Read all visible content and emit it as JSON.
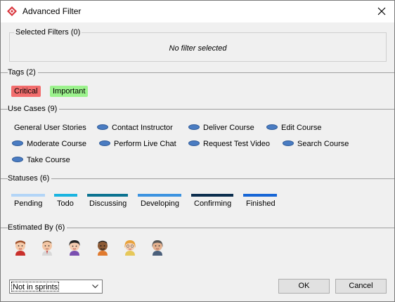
{
  "window": {
    "title": "Advanced Filter"
  },
  "selected_filters": {
    "label": "Selected Filters (0)",
    "empty_text": "No filter selected"
  },
  "tags": {
    "label": "Tags (2)",
    "items": [
      {
        "label": "Critical",
        "color": "#f26d6d"
      },
      {
        "label": "Important",
        "color": "#9cf28d"
      }
    ]
  },
  "use_cases": {
    "label": "Use Cases (9)",
    "items": [
      {
        "label": "General User Stories",
        "icon": "none"
      },
      {
        "label": "Contact Instructor",
        "icon": "use-case-icon"
      },
      {
        "label": "Deliver Course",
        "icon": "use-case-icon"
      },
      {
        "label": "Edit Course",
        "icon": "use-case-icon"
      },
      {
        "label": "Moderate Course",
        "icon": "use-case-icon"
      },
      {
        "label": "Perform Live Chat",
        "icon": "use-case-icon"
      },
      {
        "label": "Request Test Video",
        "icon": "use-case-icon"
      },
      {
        "label": "Search Course",
        "icon": "use-case-icon"
      },
      {
        "label": "Take Course",
        "icon": "use-case-icon"
      }
    ]
  },
  "statuses": {
    "label": "Statuses (6)",
    "items": [
      {
        "label": "Pending",
        "color": "#b3d5f7"
      },
      {
        "label": "Todo",
        "color": "#1ab4e0"
      },
      {
        "label": "Discussing",
        "color": "#0b7391"
      },
      {
        "label": "Developing",
        "color": "#3c93e0"
      },
      {
        "label": "Confirming",
        "color": "#0c2e4e"
      },
      {
        "label": "Finished",
        "color": "#1766d6"
      }
    ]
  },
  "estimated_by": {
    "label": "Estimated By (6)",
    "avatars": [
      "avatar-1",
      "avatar-2",
      "avatar-3",
      "avatar-4",
      "avatar-5",
      "avatar-6"
    ]
  },
  "sprint_filter": {
    "value": "Not in sprints"
  },
  "buttons": {
    "ok": "OK",
    "cancel": "Cancel"
  }
}
